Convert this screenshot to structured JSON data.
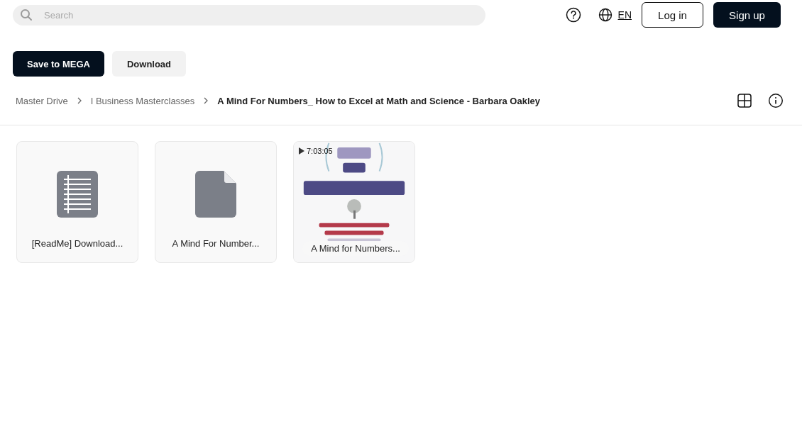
{
  "search": {
    "placeholder": "Search"
  },
  "header": {
    "language": "EN",
    "buttons": [
      {
        "label": "Log in",
        "kind": "outline"
      },
      {
        "label": "Sign up",
        "kind": "primary"
      }
    ]
  },
  "actions": [
    {
      "label": "Save to MEGA",
      "kind": "primary"
    },
    {
      "label": "Download",
      "kind": "secondary"
    }
  ],
  "breadcrumb": [
    {
      "label": "Master Drive",
      "current": false
    },
    {
      "label": "I Business Masterclasses",
      "current": false
    },
    {
      "label": "A Mind For Numbers_ How to Excel at Math and Science - Barbara Oakley",
      "current": true
    }
  ],
  "files": [
    {
      "kind": "text",
      "name": "[ReadMe] Download..."
    },
    {
      "kind": "file",
      "name": "A Mind For Number..."
    },
    {
      "kind": "video",
      "name": "A Mind for Numbers...",
      "duration": "7:03:05"
    }
  ]
}
